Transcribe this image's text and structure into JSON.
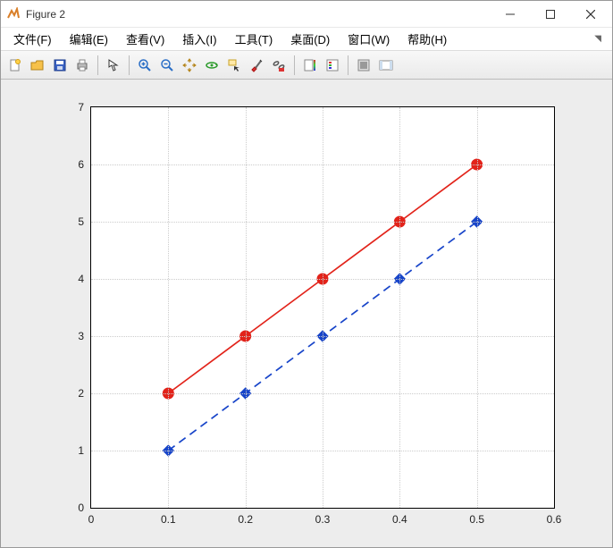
{
  "window": {
    "title": "Figure 2"
  },
  "menu": {
    "file": "文件(F)",
    "edit": "编辑(E)",
    "view": "查看(V)",
    "insert": "插入(I)",
    "tools": "工具(T)",
    "desktop": "桌面(D)",
    "window": "窗口(W)",
    "help": "帮助(H)"
  },
  "toolbar_icons": {
    "new": "new-figure",
    "open": "open-file",
    "save": "save",
    "print": "print",
    "pointer": "edit-plot",
    "zoomin": "zoom-in",
    "zoomout": "zoom-out",
    "pan": "pan",
    "rotate": "rotate-3d",
    "datacursor": "data-cursor",
    "brush": "brush",
    "linkdata": "link-data",
    "colorbar": "insert-colorbar",
    "legend": "insert-legend",
    "hideplot": "hide-plot-tools",
    "showplot": "show-plot-tools"
  },
  "chart_data": {
    "type": "line",
    "x": [
      0.1,
      0.2,
      0.3,
      0.4,
      0.5
    ],
    "series": [
      {
        "name": "series-red",
        "values": [
          2,
          3,
          4,
          5,
          6
        ],
        "color": "#e2231a",
        "marker": "circle",
        "line": "solid"
      },
      {
        "name": "series-blue",
        "values": [
          1,
          2,
          3,
          4,
          5
        ],
        "color": "#1744c9",
        "marker": "diamond",
        "line": "dashed"
      }
    ],
    "xlim": [
      0,
      0.6
    ],
    "ylim": [
      0,
      7
    ],
    "xticks": [
      0,
      0.1,
      0.2,
      0.3,
      0.4,
      0.5,
      0.6
    ],
    "yticks": [
      0,
      1,
      2,
      3,
      4,
      5,
      6,
      7
    ],
    "grid": "dotted",
    "title": "",
    "xlabel": "",
    "ylabel": ""
  }
}
